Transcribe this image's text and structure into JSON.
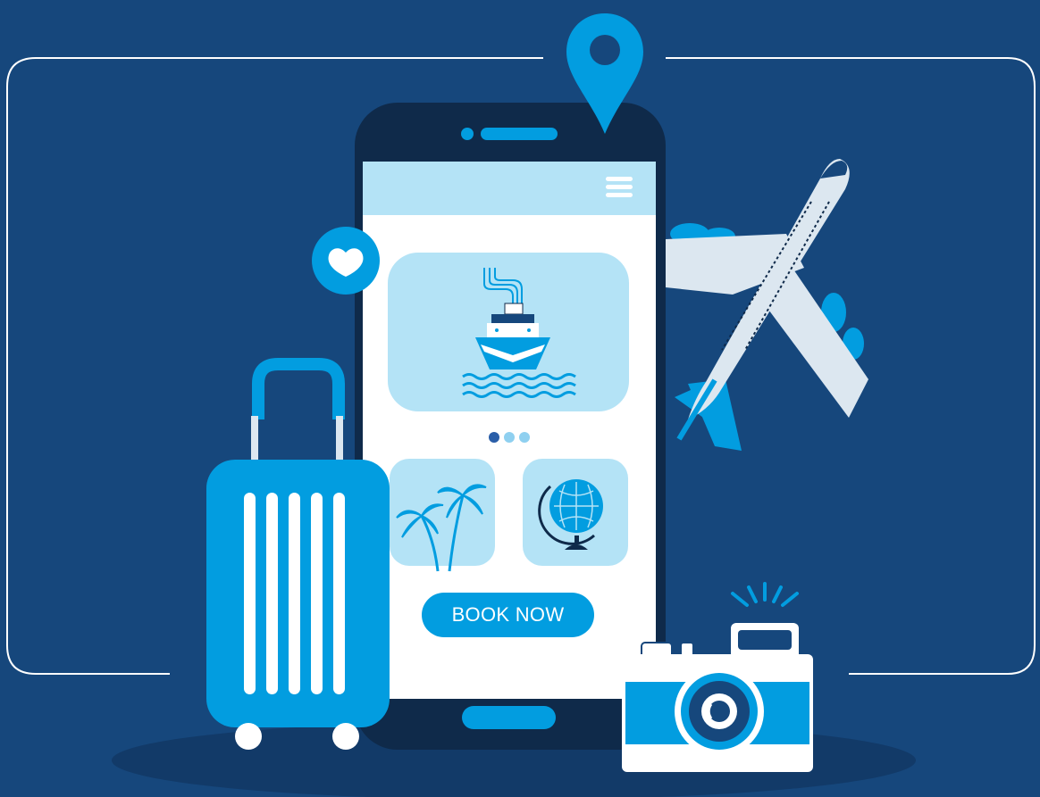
{
  "colors": {
    "background": "#16477c",
    "accent": "#029de0",
    "phone_body": "#0f2a4a",
    "screen_header": "#b4e3f6",
    "card_fill": "#b4e3f6",
    "screen_fill": "#ffffff"
  },
  "app": {
    "menu_icon": "hamburger-menu-icon",
    "carousel": {
      "slides": 3,
      "active_index": 0,
      "current_icon": "cruise-ship-icon"
    },
    "tiles": [
      {
        "icon": "palm-trees-icon"
      },
      {
        "icon": "globe-icon"
      }
    ],
    "cta_label": "BOOK NOW"
  },
  "decorations": {
    "location_pin": "location-pin-icon",
    "favorite_badge": "heart-icon",
    "airplane": "airplane-icon",
    "suitcase": "suitcase-icon",
    "camera": "camera-icon"
  }
}
